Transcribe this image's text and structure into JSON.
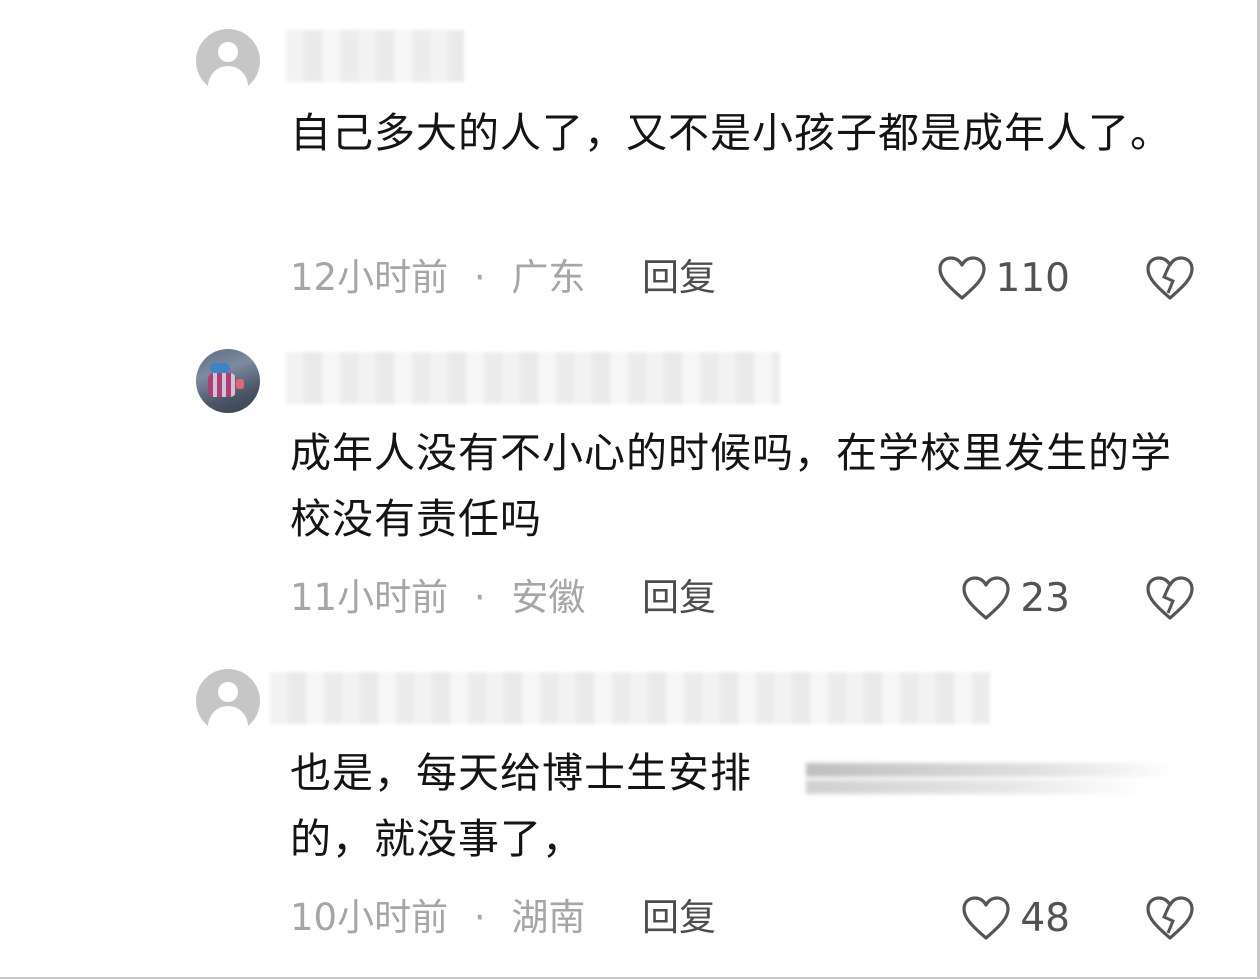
{
  "comments": [
    {
      "username": "",
      "text": "自己多大的人了，又不是小孩子都是成年人了。",
      "time": "12小时前",
      "location": "广东",
      "reply_label": "回复",
      "likes": "110"
    },
    {
      "username": "",
      "text": "成年人没有不小心的时候吗，在学校里发生的学校没有责任吗",
      "time": "11小时前",
      "location": "安徽",
      "reply_label": "回复",
      "likes": "23"
    },
    {
      "username": "",
      "text": "也是，每天给博士生安排的，就没事了，",
      "time": "10小时前",
      "location": "湖南",
      "reply_label": "回复",
      "likes": "48"
    }
  ],
  "meta_separator": "·",
  "icons": {
    "like": "heart-outline-icon",
    "dislike": "broken-heart-icon",
    "avatar_default": "default-avatar-icon"
  },
  "colors": {
    "text": "#141414",
    "meta": "#a6a6a6",
    "reply": "#4d4d4d",
    "avatar_bg": "#c6c6c6"
  }
}
